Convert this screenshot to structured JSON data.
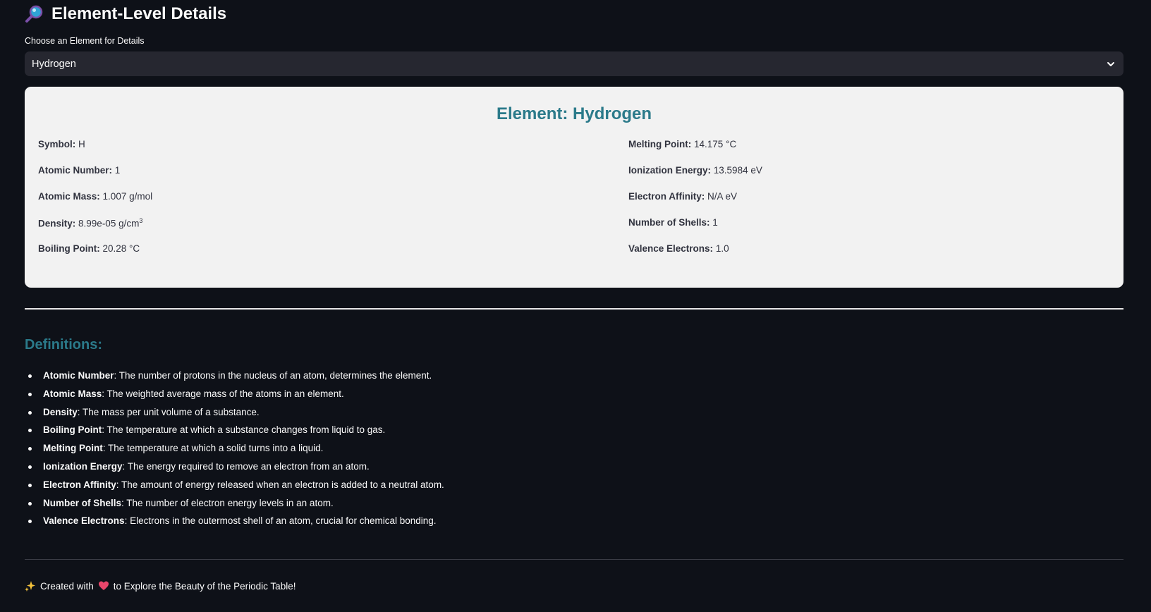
{
  "header": {
    "title": "Element-Level Details",
    "icon": "magnifying-glass-icon"
  },
  "selector": {
    "label": "Choose an Element for Details",
    "value": "Hydrogen"
  },
  "card": {
    "title": "Element: Hydrogen",
    "left": [
      {
        "key": "Symbol:",
        "value": "H"
      },
      {
        "key": "Atomic Number:",
        "value": "1"
      },
      {
        "key": "Atomic Mass:",
        "value": "1.007 g/mol"
      },
      {
        "key": "Density:",
        "value": "8.99e-05 g/cm",
        "sup": "3"
      },
      {
        "key": "Boiling Point:",
        "value": "20.28 °C"
      }
    ],
    "right": [
      {
        "key": "Melting Point:",
        "value": "14.175 °C"
      },
      {
        "key": "Ionization Energy:",
        "value": "13.5984 eV"
      },
      {
        "key": "Electron Affinity:",
        "value": "N/A eV"
      },
      {
        "key": "Number of Shells:",
        "value": "1"
      },
      {
        "key": "Valence Electrons:",
        "value": "1.0"
      }
    ]
  },
  "definitions": {
    "heading": "Definitions:",
    "items": [
      {
        "term": "Atomic Number",
        "text": ": The number of protons in the nucleus of an atom, determines the element."
      },
      {
        "term": "Atomic Mass",
        "text": ": The weighted average mass of the atoms in an element."
      },
      {
        "term": "Density",
        "text": ": The mass per unit volume of a substance."
      },
      {
        "term": "Boiling Point",
        "text": ": The temperature at which a substance changes from liquid to gas."
      },
      {
        "term": "Melting Point",
        "text": ": The temperature at which a solid turns into a liquid."
      },
      {
        "term": "Ionization Energy",
        "text": ": The energy required to remove an electron from an atom."
      },
      {
        "term": "Electron Affinity",
        "text": ": The amount of energy released when an electron is added to a neutral atom."
      },
      {
        "term": "Number of Shells",
        "text": ": The number of electron energy levels in an atom."
      },
      {
        "term": "Valence Electrons",
        "text": ": Electrons in the outermost shell of an atom, crucial for chemical bonding."
      }
    ]
  },
  "footer": {
    "before": "Created with",
    "after": "to Explore the Beauty of the Periodic Table!",
    "icons": [
      "sparkles-icon",
      "heart-icon"
    ]
  },
  "colors": {
    "background": "#0e1118",
    "accent": "#2b7a8a",
    "card": "#f2f2f2",
    "select": "#262730"
  }
}
